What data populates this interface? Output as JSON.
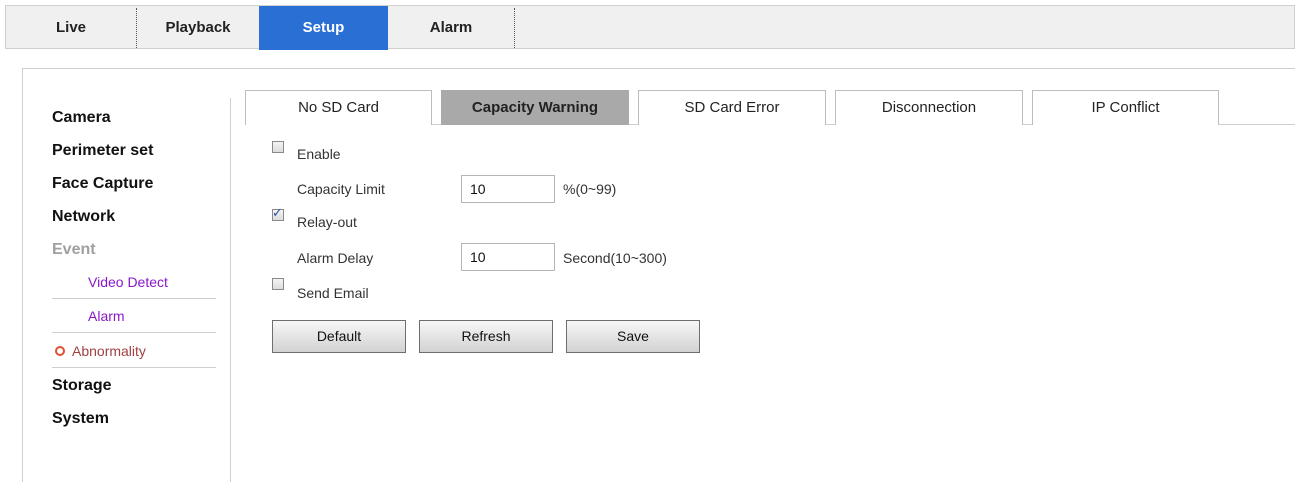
{
  "topnav": {
    "tabs": [
      {
        "label": "Live"
      },
      {
        "label": "Playback"
      },
      {
        "label": "Setup"
      },
      {
        "label": "Alarm"
      }
    ],
    "active_color": "#2a70d4"
  },
  "sidebar": {
    "items": [
      {
        "label": "Camera"
      },
      {
        "label": "Perimeter set"
      },
      {
        "label": "Face Capture"
      },
      {
        "label": "Network"
      },
      {
        "label": "Event"
      },
      {
        "label": "Storage"
      },
      {
        "label": "System"
      }
    ],
    "event_subitems": [
      {
        "label": "Video Detect"
      },
      {
        "label": "Alarm"
      },
      {
        "label": "Abnormality"
      }
    ]
  },
  "subtabs": [
    {
      "label": "No SD Card"
    },
    {
      "label": "Capacity Warning"
    },
    {
      "label": "SD Card Error"
    },
    {
      "label": "Disconnection"
    },
    {
      "label": "IP Conflict"
    }
  ],
  "form": {
    "enable": {
      "label": "Enable",
      "checked": false
    },
    "capacity_limit": {
      "label": "Capacity Limit",
      "value": "10",
      "hint": "%(0~99)"
    },
    "relay_out": {
      "label": "Relay-out",
      "checked": true
    },
    "alarm_delay": {
      "label": "Alarm Delay",
      "value": "10",
      "hint": "Second(10~300)"
    },
    "send_email": {
      "label": "Send Email",
      "checked": false
    }
  },
  "buttons": {
    "default_label": "Default",
    "refresh_label": "Refresh",
    "save_label": "Save"
  }
}
